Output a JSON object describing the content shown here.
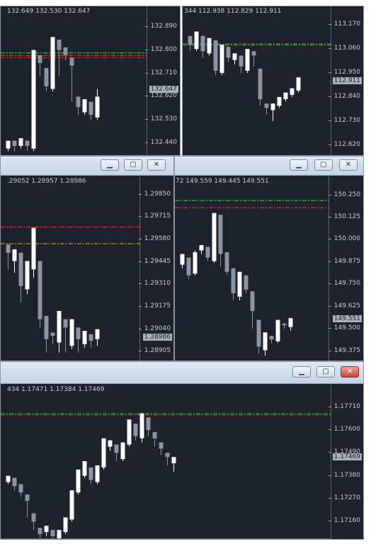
{
  "windows": [
    {
      "id": "w1",
      "ohlc": "132.649 132.530 132.647",
      "ticks": [
        "132.890",
        "132.800",
        "132.710",
        "132.620",
        "132.530",
        "132.440"
      ],
      "price": "132.647",
      "ymin": 132.4,
      "ymax": 132.93,
      "levels": [
        {
          "value": 132.789,
          "color": "#1fbf3a"
        },
        {
          "value": 132.779,
          "color": "#e03030"
        },
        {
          "value": 132.771,
          "color": "#e03030"
        }
      ],
      "candles": [
        [
          132.42,
          132.45,
          132.41,
          132.44
        ],
        [
          132.45,
          132.43,
          132.41,
          132.42
        ],
        [
          132.43,
          132.46,
          132.42,
          132.45
        ],
        [
          132.45,
          132.43,
          132.41,
          132.42
        ],
        [
          132.42,
          132.8,
          132.41,
          132.78
        ],
        [
          132.78,
          132.75,
          132.7,
          132.72
        ],
        [
          132.73,
          132.66,
          132.64,
          132.65
        ],
        [
          132.65,
          132.85,
          132.64,
          132.84
        ],
        [
          132.84,
          132.8,
          132.7,
          132.82
        ],
        [
          132.81,
          132.78,
          132.76,
          132.77
        ],
        [
          132.77,
          132.74,
          132.6,
          132.62
        ],
        [
          132.62,
          132.58,
          132.55,
          132.56
        ],
        [
          132.56,
          132.61,
          132.55,
          132.6
        ],
        [
          132.6,
          132.55,
          132.53,
          132.54
        ],
        [
          132.54,
          132.62,
          132.53,
          132.65
        ]
      ]
    },
    {
      "id": "w2",
      "ohlc": "344 112.938 112.829 112.911",
      "ticks": [
        "113.170",
        "113.060",
        "112.950",
        "112.840",
        "112.730",
        "112.620"
      ],
      "price": "112.911",
      "ymin": 112.58,
      "ymax": 113.21,
      "levels": [
        {
          "value": 113.083,
          "color": "#1fbf3a"
        },
        {
          "value": 113.078,
          "color": "#e03030"
        }
      ],
      "candles": [
        [
          113.12,
          113.08,
          113.05,
          113.06
        ],
        [
          113.06,
          113.14,
          113.05,
          113.13
        ],
        [
          113.12,
          113.05,
          113.02,
          113.04
        ],
        [
          113.04,
          113.11,
          113.03,
          113.1
        ],
        [
          113.1,
          112.96,
          112.94,
          112.95
        ],
        [
          112.95,
          113.08,
          112.94,
          113.07
        ],
        [
          113.07,
          113.02,
          113.0,
          113.01
        ],
        [
          113.01,
          113.04,
          112.99,
          113.03
        ],
        [
          113.03,
          112.98,
          112.95,
          112.96
        ],
        [
          112.96,
          113.06,
          112.95,
          113.05
        ],
        [
          113.05,
          113.03,
          112.98,
          112.97
        ],
        [
          112.97,
          112.83,
          112.8,
          112.81
        ],
        [
          112.81,
          112.79,
          112.76,
          112.78
        ],
        [
          112.78,
          112.81,
          112.73,
          112.8
        ],
        [
          112.8,
          112.84,
          112.79,
          112.83
        ],
        [
          112.83,
          112.86,
          112.82,
          112.85
        ],
        [
          112.85,
          112.88,
          112.84,
          112.87
        ],
        [
          112.87,
          112.93,
          112.86,
          112.91
        ]
      ]
    },
    {
      "id": "w3",
      "ohlc": ".29052 1.28957 1.28986",
      "ticks": [
        "1.29850",
        "1.29715",
        "1.29580",
        "1.29445",
        "1.29310",
        "1.29175",
        "1.29040",
        "1.28905"
      ],
      "price": "1.28986",
      "ymin": 1.2886,
      "ymax": 1.299,
      "levels": [
        {
          "value": 1.29655,
          "color": "#e03030"
        },
        {
          "value": 1.29555,
          "color": "#e0a020"
        }
      ],
      "candles": [
        [
          1.2955,
          1.295,
          1.294,
          1.2945
        ],
        [
          1.2945,
          1.2952,
          1.2938,
          1.295
        ],
        [
          1.295,
          1.293,
          1.292,
          1.2928
        ],
        [
          1.2928,
          1.2945,
          1.2925,
          1.294
        ],
        [
          1.294,
          1.2965,
          1.2935,
          1.296
        ],
        [
          1.2945,
          1.291,
          1.2905,
          1.2912
        ],
        [
          1.2912,
          1.2898,
          1.289,
          1.2902
        ],
        [
          1.2902,
          1.29,
          1.2895,
          1.2896
        ],
        [
          1.2896,
          1.2915,
          1.289,
          1.291
        ],
        [
          1.291,
          1.2905,
          1.289,
          1.2894
        ],
        [
          1.2894,
          1.291,
          1.2892,
          1.2908
        ],
        [
          1.2905,
          1.2898,
          1.289,
          1.2895
        ],
        [
          1.2895,
          1.2903,
          1.2893,
          1.2901
        ],
        [
          1.2901,
          1.2897,
          1.2893,
          1.2898
        ],
        [
          1.2898,
          1.2904,
          1.2894,
          1.2899
        ]
      ]
    },
    {
      "id": "w4",
      "ohlc": "72 149.559 149.445 149.551",
      "ticks": [
        "150.250",
        "150.125",
        "150.000",
        "149.875",
        "149.750",
        "149.625",
        "149.500",
        "149.375"
      ],
      "price": "149.551",
      "ymin": 149.33,
      "ymax": 150.3,
      "levels": [
        {
          "value": 150.22,
          "color": "#1fbf3a"
        },
        {
          "value": 150.18,
          "color": "#e03030"
        }
      ],
      "candles": [
        [
          149.86,
          149.92,
          149.84,
          149.9
        ],
        [
          149.9,
          149.8,
          149.78,
          149.81
        ],
        [
          149.81,
          149.93,
          149.8,
          149.94
        ],
        [
          149.94,
          149.97,
          149.92,
          149.96
        ],
        [
          149.96,
          149.9,
          149.88,
          149.88
        ],
        [
          149.88,
          150.15,
          149.87,
          150.14
        ],
        [
          150.14,
          149.92,
          149.85,
          149.93
        ],
        [
          149.93,
          149.82,
          149.8,
          149.84
        ],
        [
          149.84,
          149.7,
          149.66,
          149.68
        ],
        [
          149.68,
          149.82,
          149.66,
          149.8
        ],
        [
          149.8,
          149.72,
          149.7,
          149.71
        ],
        [
          149.71,
          149.6,
          149.5,
          149.55
        ],
        [
          149.55,
          149.4,
          149.36,
          149.38
        ],
        [
          149.38,
          149.48,
          149.35,
          149.46
        ],
        [
          149.46,
          149.44,
          149.42,
          149.43
        ],
        [
          149.43,
          149.55,
          149.42,
          149.53
        ],
        [
          149.53,
          149.52,
          149.5,
          149.51
        ],
        [
          149.51,
          149.56,
          149.49,
          149.55
        ]
      ]
    },
    {
      "id": "w5",
      "ohlc": "434 1.17471 1.17384 1.17469",
      "ticks": [
        "1.17710",
        "1.17600",
        "1.17490",
        "1.17380",
        "1.17270",
        "1.17160"
      ],
      "price": "1.17469",
      "ymin": 1.1709,
      "ymax": 1.1777,
      "levels": [
        {
          "value": 1.17678,
          "color": "#1fbf3a"
        },
        {
          "value": 1.17672,
          "color": "#e03030"
        }
      ],
      "candles": [
        [
          1.1735,
          1.1738,
          1.1734,
          1.1737
        ],
        [
          1.1737,
          1.1733,
          1.1731,
          1.1734
        ],
        [
          1.1734,
          1.173,
          1.1728,
          1.1729
        ],
        [
          1.1729,
          1.1726,
          1.1718,
          1.172
        ],
        [
          1.172,
          1.1716,
          1.1712,
          1.1713
        ],
        [
          1.1713,
          1.171,
          1.1708,
          1.1711
        ],
        [
          1.1711,
          1.1714,
          1.1709,
          1.1712
        ],
        [
          1.1712,
          1.1709,
          1.1707,
          1.1708
        ],
        [
          1.1708,
          1.1712,
          1.1707,
          1.1711
        ],
        [
          1.1711,
          1.1718,
          1.171,
          1.1717
        ],
        [
          1.1717,
          1.1731,
          1.1716,
          1.173
        ],
        [
          1.173,
          1.1741,
          1.1729,
          1.1738
        ],
        [
          1.1738,
          1.1745,
          1.1737,
          1.1742
        ],
        [
          1.1742,
          1.1736,
          1.1734,
          1.1735
        ],
        [
          1.1735,
          1.1743,
          1.1734,
          1.1742
        ],
        [
          1.1742,
          1.1756,
          1.1741,
          1.1752
        ],
        [
          1.1752,
          1.1755,
          1.175,
          1.1753
        ],
        [
          1.1753,
          1.1749,
          1.1745,
          1.1746
        ],
        [
          1.1746,
          1.1754,
          1.1745,
          1.1753
        ],
        [
          1.1753,
          1.1765,
          1.1752,
          1.1763
        ],
        [
          1.1763,
          1.1757,
          1.1755,
          1.1756
        ],
        [
          1.1756,
          1.1768,
          1.1754,
          1.1766
        ],
        [
          1.1766,
          1.176,
          1.1757,
          1.1759
        ],
        [
          1.1759,
          1.1756,
          1.1752,
          1.1754
        ],
        [
          1.1754,
          1.1751,
          1.1748,
          1.1749
        ],
        [
          1.1749,
          1.1747,
          1.1743,
          1.1744
        ],
        [
          1.1744,
          1.1747,
          1.174,
          1.1746
        ]
      ]
    }
  ],
  "colors": {
    "bull": "#ffffff",
    "bear": "#8b94a3",
    "bg": "#1e222b"
  }
}
